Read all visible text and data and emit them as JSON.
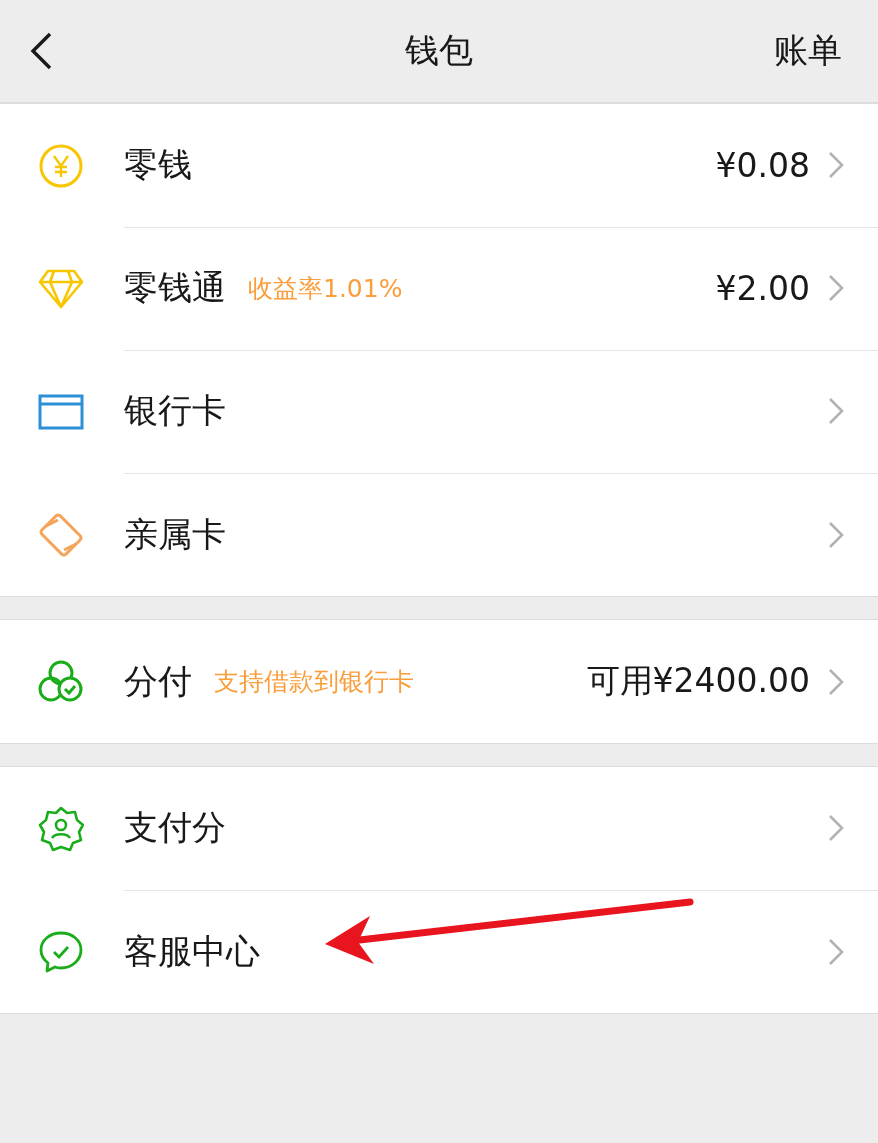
{
  "header": {
    "title": "钱包",
    "action": "账单"
  },
  "groups": [
    {
      "rows": [
        {
          "kind": "coin",
          "label": "零钱",
          "value": "¥0.08"
        },
        {
          "kind": "diamond",
          "label": "零钱通",
          "tag": "收益率1.01%",
          "value": "¥2.00"
        },
        {
          "kind": "card",
          "label": "银行卡"
        },
        {
          "kind": "family",
          "label": "亲属卡"
        }
      ]
    },
    {
      "rows": [
        {
          "kind": "clover",
          "label": "分付",
          "tag": "支持借款到银行卡",
          "value": "可用¥2400.00"
        }
      ]
    },
    {
      "rows": [
        {
          "kind": "badge",
          "label": "支付分"
        },
        {
          "kind": "chat",
          "label": "客服中心"
        }
      ]
    }
  ]
}
